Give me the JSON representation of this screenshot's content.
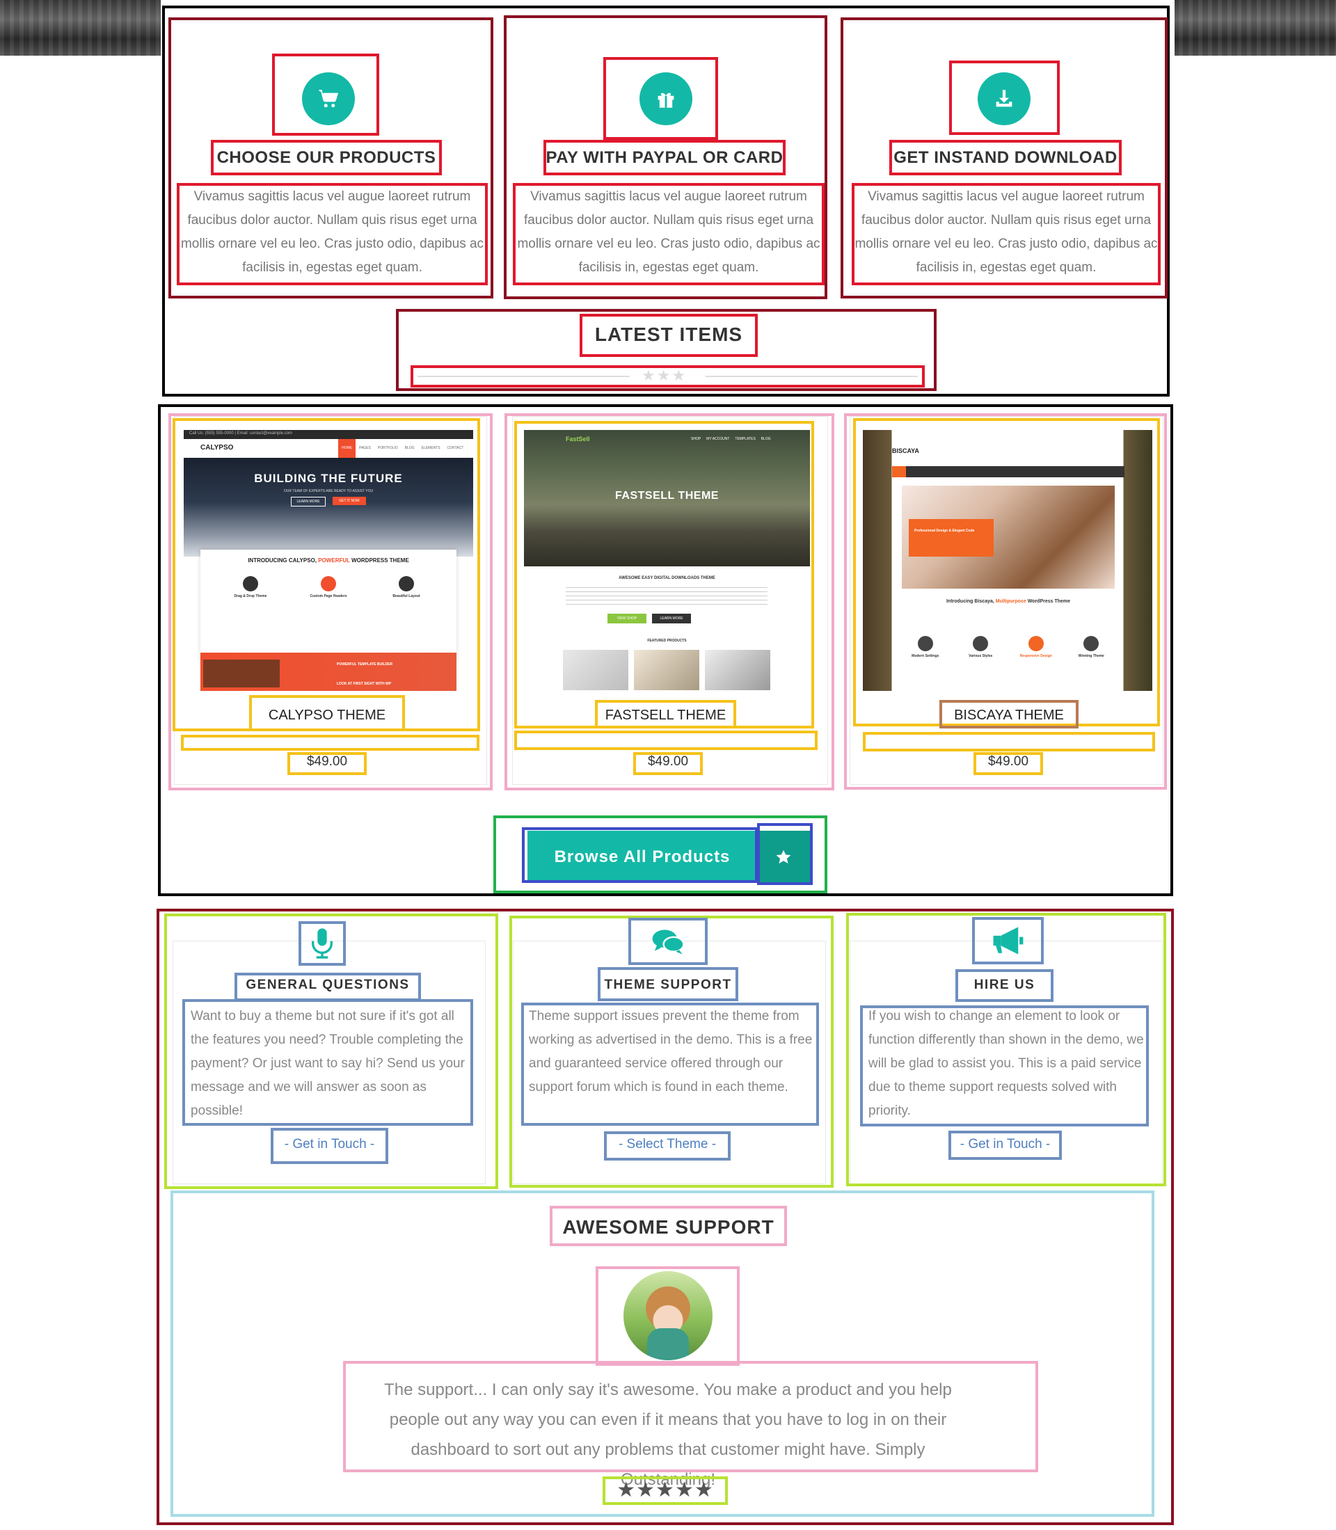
{
  "features": [
    {
      "icon": "cart-icon",
      "title": "CHOOSE OUR PRODUCTS",
      "text": "Vivamus sagittis lacus vel augue laoreet rutrum faucibus dolor auctor. Nullam quis risus eget urna mollis ornare vel eu leo. Cras justo odio, dapibus ac facilisis in, egestas eget quam."
    },
    {
      "icon": "gift-icon",
      "title": "PAY WITH PAYPAL OR CARD",
      "text": "Vivamus sagittis lacus vel augue laoreet rutrum faucibus dolor auctor. Nullam quis risus eget urna mollis ornare vel eu leo. Cras justo odio, dapibus ac facilisis in, egestas eget quam."
    },
    {
      "icon": "download-icon",
      "title": "GET INSTAND DOWNLOAD",
      "text": "Vivamus sagittis lacus vel augue laoreet rutrum faucibus dolor auctor. Nullam quis risus eget urna mollis ornare vel eu leo. Cras justo odio, dapibus ac facilisis in, egestas eget quam."
    }
  ],
  "latest": {
    "title": "LATEST ITEMS"
  },
  "products": [
    {
      "title": "CALYPSO THEME",
      "price": "$49.00",
      "shot": {
        "logo": "CALYPSO",
        "topbar": "Call Us: (555) 555-0000 | Email: contact@example.com",
        "nav": [
          "HOME",
          "PAGES",
          "PORTFOLIO",
          "BLOG",
          "ELEMENTS",
          "CONTACT"
        ],
        "headline": "BUILDING THE FUTURE",
        "sub": "OUR TEAM OF EXPERTS ARE READY TO ASSIST YOU",
        "btn1": "LEARN MORE",
        "btn2": "GET IT NOW",
        "intro_pre": "INTRODUCING CALYPSO,",
        "intro_em": "POWERFUL",
        "intro_post": "WORDPRESS THEME",
        "features": [
          "Drag & Drop Theme",
          "Custom Page Headers",
          "Beautiful Layout"
        ],
        "promo1": "POWERFUL TEMPLATE BUILDER",
        "promo2": "LOOK AT FIRST SIGHT WITH WP"
      }
    },
    {
      "title": "FASTSELL THEME",
      "price": "$49.00",
      "shot": {
        "logo": "FastSell",
        "nav": [
          "SHOP",
          "MY ACCOUNT",
          "TEMPLATES",
          "BLOG"
        ],
        "headline": "FASTSELL THEME",
        "tagline": "AWESOME EASY DIGITAL DOWNLOADS THEME",
        "btn1": "VIEW SHOP",
        "btn2": "LEARN MORE",
        "featured": "FEATURED PRODUCTS"
      }
    },
    {
      "title": "BISCAYA THEME",
      "price": "$49.00",
      "shot": {
        "logo": "BISCAYA",
        "banner": "Professional Design & Elegant Code",
        "intro_pre": "Introducing Biscaya,",
        "intro_em": "Multipurpose",
        "intro_post": "WordPress Theme",
        "features": [
          "Modern Settings",
          "Various Styles",
          "Responsive Design",
          "Winning Theme"
        ]
      }
    }
  ],
  "browse": {
    "label": "Browse All Products"
  },
  "help": [
    {
      "icon": "microphone-icon",
      "title": "GENERAL QUESTIONS",
      "text": "Want to buy a theme but not sure if it's got all the features you need? Trouble completing the payment? Or just want to say hi? Send us your message and we will answer as soon as possible!",
      "link": "- Get in Touch -"
    },
    {
      "icon": "chat-bubbles-icon",
      "title": "THEME SUPPORT",
      "text": "Theme support issues prevent the theme from working as advertised in the demo. This is a free and guaranteed service offered through our support forum which is found in each theme.",
      "link": "- Select Theme -"
    },
    {
      "icon": "megaphone-icon",
      "title": "HIRE US",
      "text": "If you wish to change an element to look or function differently than shown in the demo, we will be glad to assist you. This is a paid service due to theme support requests solved with priority.",
      "link": "- Get in Touch -"
    }
  ],
  "support": {
    "title": "AWESOME SUPPORT",
    "quote": "The support... I can only say it's awesome. You make a product and you help people out any way you can even if it means that you have to log in on their dashboard to sort out any problems that customer might have. Simply Outstanding!",
    "rating": 5
  },
  "colors": {
    "accent": "#13b9a6",
    "accent_dark": "#0e9c8b",
    "link": "#4f7fc0",
    "orange": "#f26522"
  }
}
